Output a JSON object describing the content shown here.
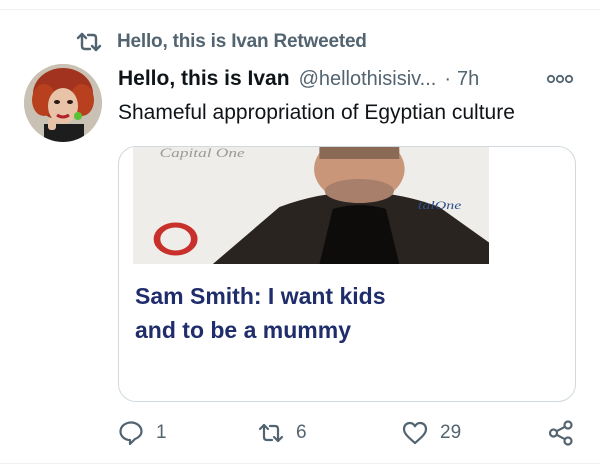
{
  "retweet_context": {
    "icon": "retweet-icon",
    "text": "Hello, this is Ivan Retweeted"
  },
  "tweet": {
    "author_name": "Hello, this is Ivan",
    "handle": "@hellothisisiv...",
    "separator": "·",
    "timestamp": "7h",
    "more_icon": "more-options-icon",
    "text": "Shameful appropriation of Egyptian culture"
  },
  "card": {
    "headline_line1": "Sam Smith: I want kids",
    "headline_line2": "and to be a mummy"
  },
  "actions": {
    "reply": {
      "icon": "reply-icon",
      "count": "1"
    },
    "retweet": {
      "icon": "retweet-icon",
      "count": "6"
    },
    "like": {
      "icon": "heart-icon",
      "count": "29"
    },
    "share": {
      "icon": "share-icon"
    }
  },
  "colors": {
    "secondary_text": "#536471",
    "primary_text": "#0f1419",
    "card_border": "#cfd9de",
    "headline": "#1f2d6b"
  }
}
